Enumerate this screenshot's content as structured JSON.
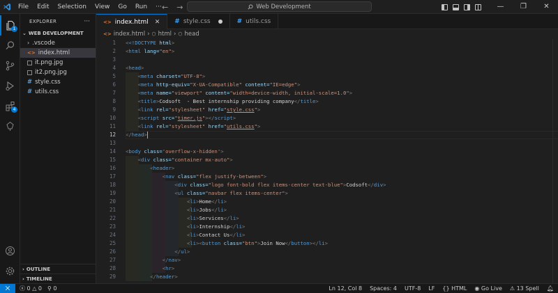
{
  "menu": [
    "File",
    "Edit",
    "Selection",
    "View",
    "Go",
    "Run",
    "···"
  ],
  "search": {
    "label": "Web Development"
  },
  "sidebar": {
    "title": "EXPLORER",
    "more": "···",
    "folder": "WEB DEVELOPMENT",
    "items": [
      {
        "name": ".vscode",
        "kind": "folder"
      },
      {
        "name": "index.html",
        "kind": "html"
      },
      {
        "name": "it.png.jpg",
        "kind": "image"
      },
      {
        "name": "it2.png.jpg",
        "kind": "image"
      },
      {
        "name": "style.css",
        "kind": "css"
      },
      {
        "name": "utils.css",
        "kind": "css"
      }
    ],
    "outline": "OUTLINE",
    "timeline": "TIMELINE"
  },
  "activity_badges": {
    "explorer": "1",
    "extensions": "4"
  },
  "tabs": [
    {
      "label": "index.html",
      "icon": "<>",
      "state": "active-close"
    },
    {
      "label": "style.css",
      "icon": "#",
      "state": "modified"
    },
    {
      "label": "utils.css",
      "icon": "#",
      "state": "none"
    }
  ],
  "breadcrumb": [
    "index.html",
    "html",
    "head"
  ],
  "editor": {
    "current_line": 12,
    "lines": [
      "1",
      "2",
      "3",
      "4",
      "5",
      "6",
      "7",
      "8",
      "9",
      "10",
      "11",
      "12",
      "13",
      "14",
      "15",
      "16",
      "17",
      "18",
      "19",
      "20",
      "21",
      "22",
      "23",
      "24",
      "25",
      "26",
      "27",
      "28",
      "29"
    ]
  },
  "code": {
    "doctype": "<!DOCTYPE ",
    "html_kw": "html",
    "gt": ">",
    "l2_open": "<",
    "l2_tag": "html",
    "l2_attr": " lang=",
    "l2_val": "\"en\"",
    "l4": "head",
    "meta": "meta",
    "charset": " charset=",
    "charset_v": "\"UTF-8\"",
    "httpeq": " http-equiv=",
    "httpeq_v": "\"X-UA-Compatible\"",
    "content": " content=",
    "content_v1": "\"IE=edge\"",
    "name": " name=",
    "name_v": "\"viewport\"",
    "content_v2": "\"width=device-width, initial-scale=1.0\"",
    "title_tag": "title",
    "title_text": "Codsoft  - Best internship providing company",
    "link": "link",
    "rel": " rel=",
    "rel_v": "\"stylesheet\"",
    "href": " href=",
    "style_css": "style.css",
    "utils_css": "utils.css",
    "script": "script",
    "src": " src=",
    "timer_js": "timer.js",
    "body": "body",
    "class": " class=",
    "body_cls": "'overflow-x-hidden'",
    "div": "div",
    "div_cls": "\"container mx-auto\"",
    "header": "header",
    "nav": "nav",
    "nav_cls": "\"flex justify-between\"",
    "logo_cls": "\"logo font-bold flex items-center text-blue\"",
    "logo_text": "Codsoft",
    "ul": "ul",
    "ul_cls": "\"navbar flex items-center\"",
    "li": "li",
    "home": "Home",
    "jobs": "Jobs",
    "services": "Services",
    "internship": "Internship",
    "contact": "Contact Us",
    "button": "button",
    "btn_cls": "\"btn\"",
    "join": "Join Now",
    "hr": "hr"
  },
  "status": {
    "errors": "0",
    "warnings": "0",
    "ports": "0",
    "position": "Ln 12, Col 8",
    "spaces": "Spaces: 4",
    "encoding": "UTF-8",
    "eol": "LF",
    "language": "HTML",
    "golive": "Go Live",
    "spell": "13 Spell"
  },
  "colors": {
    "accent": "#0078d4",
    "tag": "#569cd6",
    "attr": "#9cdcfe",
    "string": "#ce9178"
  }
}
